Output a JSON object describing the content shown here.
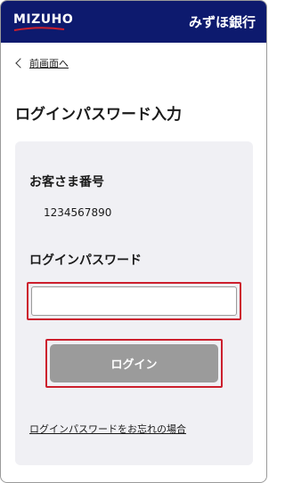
{
  "header": {
    "logo_text": "MIZUHO",
    "bank_name": "みずほ銀行"
  },
  "nav": {
    "back_label": "前画面へ"
  },
  "page": {
    "title": "ログインパスワード入力"
  },
  "form": {
    "customer_number_label": "お客さま番号",
    "customer_number_value": "1234567890",
    "password_label": "ログインパスワード",
    "password_value": "",
    "login_button_label": "ログイン",
    "forgot_link_label": "ログインパスワードをお忘れの場合"
  },
  "colors": {
    "header_bg": "#0d1a6e",
    "logo_accent": "#cc1f2d",
    "highlight": "#cc1f2d",
    "button_disabled": "#9b9b9b",
    "card_bg": "#f0f0f4"
  }
}
